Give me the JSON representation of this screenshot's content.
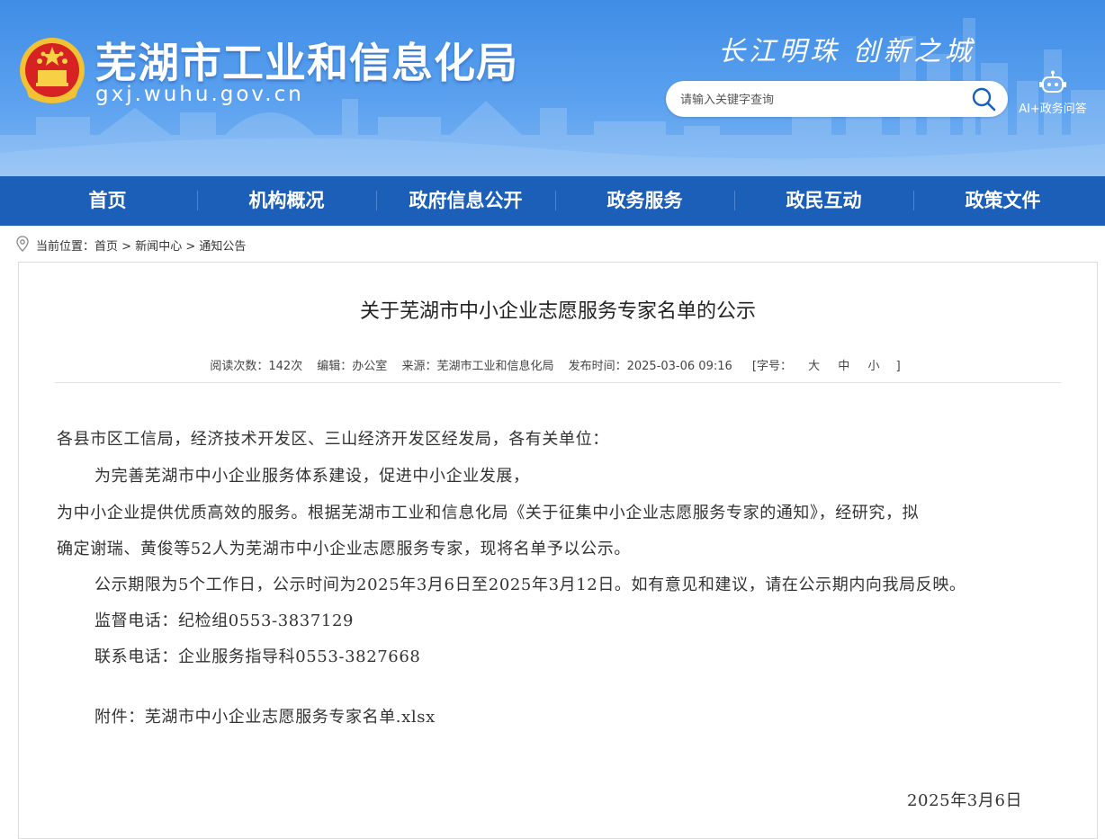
{
  "header": {
    "site_title": "芜湖市工业和信息化局",
    "site_domain": "gxj.wuhu.gov.cn",
    "slogan": "长江明珠 创新之城",
    "search_placeholder": "请输入关键字查询",
    "ai_label": "AI+政务问答"
  },
  "nav": {
    "items": [
      "首页",
      "机构概况",
      "政府信息公开",
      "政务服务",
      "政民互动",
      "政策文件"
    ]
  },
  "breadcrumb": {
    "prefix": "当前位置：",
    "items": [
      "首页",
      "新闻中心",
      "通知公告"
    ],
    "separator": ">"
  },
  "article": {
    "title": "关于芜湖市中小企业志愿服务专家名单的公示",
    "meta": {
      "reads": "阅读次数：142次",
      "editor": "编辑：办公室",
      "source": "来源：芜湖市工业和信息化局",
      "published": "发布时间：2025-03-06 09:16",
      "font_size_label": "[字号：",
      "font_large": "大",
      "font_medium": "中",
      "font_small": "小",
      "font_close": "]"
    },
    "lines": [
      "各县市区工信局，经济技术开发区、三山经济开发区经发局，各有关单位：",
      "为完善芜湖市中小企业服务体系建设，促进中小企业发展，",
      "为中小企业提供优质高效的服务。根据芜湖市工业和信息化局《关于征集中小企业志愿服务专家的通知》，经研究，拟",
      "确定谢瑞、黄俊等52人为芜湖市中小企业志愿服务专家，现将名单予以公示。",
      "公示期限为5个工作日，公示时间为2025年3月6日至2025年3月12日。如有意见和建议，请在公示期内向我局反映。",
      "监督电话：纪检组0553-3837129",
      "联系电话：企业服务指导科0553-3827668"
    ],
    "attachment_label": "附件：",
    "attachment_file": "芜湖市中小企业志愿服务专家名单.xlsx",
    "date": "2025年3月6日"
  },
  "colors": {
    "banner": "#4a93ea",
    "nav": "#1b5fb9",
    "nav_text": "#ffffff"
  }
}
